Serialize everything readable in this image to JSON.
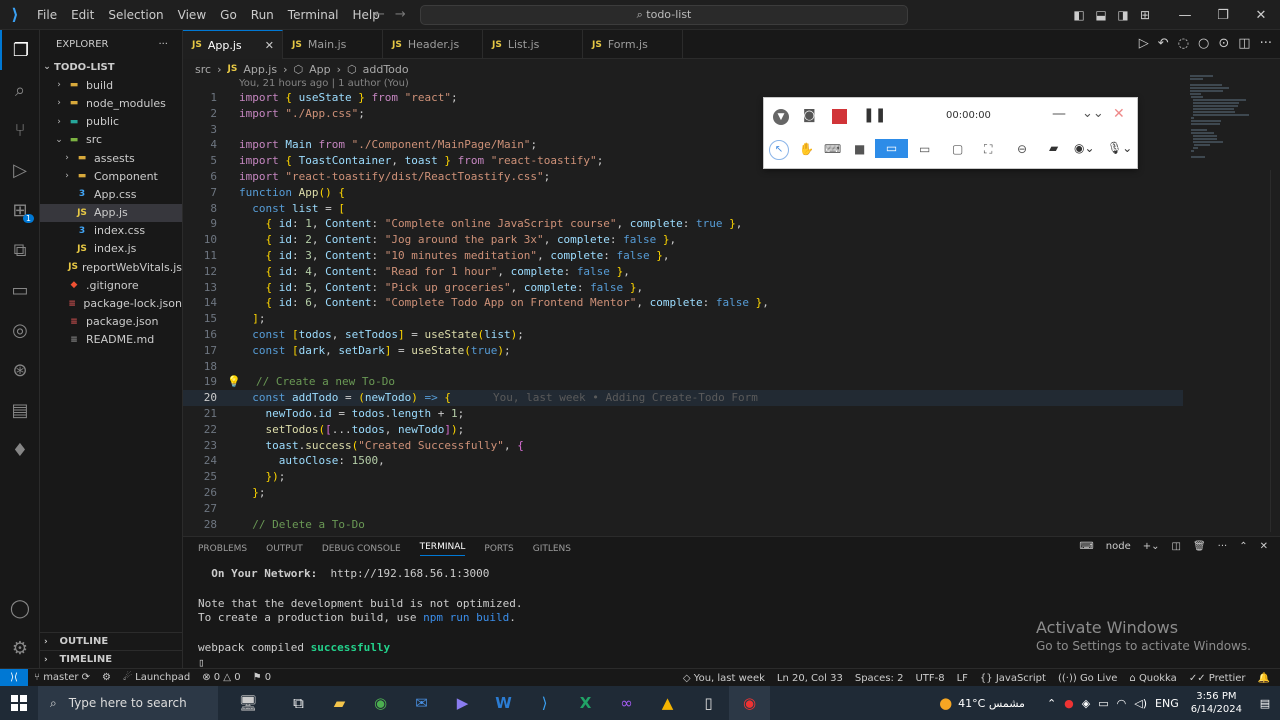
{
  "window": {
    "menu": [
      "File",
      "Edit",
      "Selection",
      "View",
      "Go",
      "Run",
      "Terminal",
      "Help"
    ],
    "search": "todo-list"
  },
  "explorer": {
    "title": "EXPLORER",
    "root": "TODO-LIST",
    "items": [
      {
        "name": "build",
        "type": "folder",
        "depth": 1,
        "open": false
      },
      {
        "name": "node_modules",
        "type": "folder",
        "depth": 1,
        "open": false
      },
      {
        "name": "public",
        "type": "folder",
        "depth": 1,
        "open": false
      },
      {
        "name": "src",
        "type": "folder",
        "depth": 1,
        "open": true
      },
      {
        "name": "assests",
        "type": "folder",
        "depth": 2,
        "open": false
      },
      {
        "name": "Component",
        "type": "folder",
        "depth": 2,
        "open": false
      },
      {
        "name": "App.css",
        "type": "css",
        "depth": 2
      },
      {
        "name": "App.js",
        "type": "js",
        "depth": 2
      },
      {
        "name": "index.css",
        "type": "css",
        "depth": 2
      },
      {
        "name": "index.js",
        "type": "js",
        "depth": 2
      },
      {
        "name": "reportWebVitals.js",
        "type": "js",
        "depth": 2
      },
      {
        "name": ".gitignore",
        "type": "git",
        "depth": 1
      },
      {
        "name": "package-lock.json",
        "type": "json",
        "depth": 1
      },
      {
        "name": "package.json",
        "type": "json",
        "depth": 1
      },
      {
        "name": "README.md",
        "type": "md",
        "depth": 1
      }
    ],
    "outline": "OUTLINE",
    "timeline": "TIMELINE"
  },
  "tabs": [
    {
      "label": "App.js",
      "active": true
    },
    {
      "label": "Main.js",
      "active": false
    },
    {
      "label": "Header.js",
      "active": false
    },
    {
      "label": "List.js",
      "active": false
    },
    {
      "label": "Form.js",
      "active": false
    }
  ],
  "breadcrumb": {
    "folder": "src",
    "file": "App.js",
    "component": "App",
    "func": "addTodo"
  },
  "author_line": "You, 21 hours ago | 1 author (You)",
  "code_blame": "You, last week • Adding Create-Todo Form",
  "current_line": 20,
  "code": [
    "import { useState } from \"react\";",
    "import \"./App.css\";",
    "",
    "import Main from \"./Component/MainPage/Main\";",
    "import { ToastContainer, toast } from \"react-toastify\";",
    "import \"react-toastify/dist/ReactToastify.css\";",
    "function App() {",
    "  const list = [",
    "    { id: 1, Content: \"Complete online JavaScript course\", complete: true },",
    "    { id: 2, Content: \"Jog around the park 3x\", complete: false },",
    "    { id: 3, Content: \"10 minutes meditation\", complete: false },",
    "    { id: 4, Content: \"Read for 1 hour\", complete: false },",
    "    { id: 5, Content: \"Pick up groceries\", complete: false },",
    "    { id: 6, Content: \"Complete Todo App on Frontend Mentor\", complete: false },",
    "  ];",
    "  const [todos, setTodos] = useState(list);",
    "  const [dark, setDark] = useState(true);",
    "",
    "  // Create a new To-Do",
    "  const addTodo = (newTodo) => {",
    "    newTodo.id = todos.length + 1;",
    "    setTodos([...todos, newTodo]);",
    "    toast.success(\"Created Successfully\", {",
    "      autoClose: 1500,",
    "    });",
    "  };",
    "",
    "  // Delete a To-Do"
  ],
  "panel": {
    "tabs": [
      "PROBLEMS",
      "OUTPUT",
      "DEBUG CONSOLE",
      "TERMINAL",
      "PORTS",
      "GITLENS"
    ],
    "active_tab": "TERMINAL",
    "shell": "node",
    "lines": [
      {
        "label": "  On Your Network:",
        "value": "http://192.168.56.1:3000"
      },
      {
        "text": ""
      },
      {
        "text": "Note that the development build is not optimized."
      },
      {
        "prefix": "To create a production build, use ",
        "cmd": "npm run build",
        "suffix": "."
      },
      {
        "text": ""
      },
      {
        "prefix": "webpack compiled ",
        "ok": "successfully"
      }
    ]
  },
  "watermark": {
    "title": "Activate Windows",
    "subtitle": "Go to Settings to activate Windows."
  },
  "statusbar": {
    "branch": "master",
    "launchpad": "Launchpad",
    "errors": "0",
    "warnings": "0",
    "ports": "0",
    "blame": "You, last week",
    "position": "Ln 20, Col 33",
    "spaces": "Spaces: 2",
    "encoding": "UTF-8",
    "eol": "LF",
    "language": "JavaScript",
    "golive": "Go Live",
    "quokka": "Quokka",
    "prettier": "Prettier"
  },
  "recorder": {
    "timer": "00:00:00"
  },
  "taskbar": {
    "search_placeholder": "Type here to search",
    "weather": "41°C",
    "weather_label": "مشمس",
    "lang": "ENG",
    "time": "3:56 PM",
    "date": "6/14/2024"
  },
  "colors": {
    "accent": "#0078d4",
    "editor_bg": "#1e1e1e",
    "sidebar_bg": "#181818",
    "record_red": "#d13438"
  }
}
